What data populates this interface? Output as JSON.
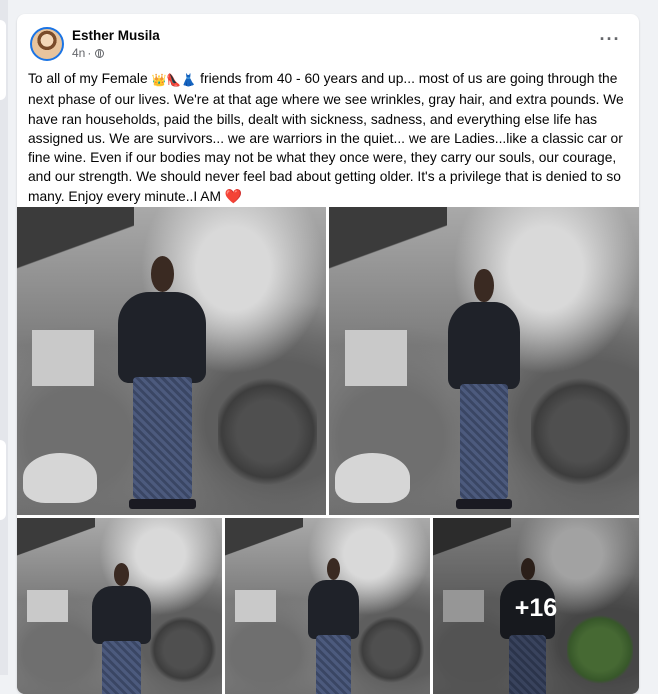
{
  "post": {
    "author": "Esther Musila",
    "time": "4n",
    "privacy_icon": "globe-icon",
    "more_icon": "ellipsis-icon",
    "text_before_emoji": "To all of my Female",
    "emojis": [
      "👑",
      "👠",
      "👗"
    ],
    "text_main": "friends from 40 - 60 years and up... most of us are going through the next phase of our lives. We're at that age where we see wrinkles, gray hair, and extra pounds. We have ran households, paid the bills, dealt with sickness, sadness, and everything else life has assigned us. We are survivors... we are warriors in the quiet... we are Ladies...like a classic car or fine wine. Even if our bodies may not be what they once were, they carry our souls, our courage, and our strength. We should never feel bad about getting older. It's a privilege that is denied to so many. Enjoy every minute..I AM",
    "heart_emoji": "❤️"
  },
  "photos": {
    "extra_count_label": "+16"
  },
  "colors": {
    "accent": "#1b74e4",
    "heart": "#e0245e"
  }
}
